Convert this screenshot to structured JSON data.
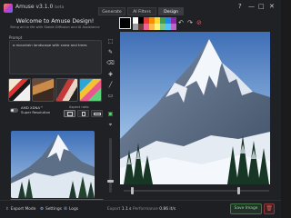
{
  "window": {
    "app_name": "Amuse",
    "version": "v3.1.0",
    "version_suffix": "beta",
    "controls": {
      "help": "?",
      "minimize": "—",
      "maximize": "□",
      "close": "✕"
    }
  },
  "tabs": [
    {
      "label": "Generate",
      "active": false
    },
    {
      "label": "AI Filters",
      "active": false
    },
    {
      "label": "Design",
      "active": true
    }
  ],
  "left_panel": {
    "welcome_title": "Welcome to Amuse Design!",
    "welcome_subtitle": "Bring art to life with Stable Diffusion and AI Assistance",
    "prompt_label": "Prompt",
    "prompt_text": "a mountain landscape with snow and trees",
    "styles": [
      "style-1",
      "style-2",
      "style-3",
      "style-4"
    ],
    "upscaler_label_line1": "AMD XDNA™",
    "upscaler_label_line2": "Super Resolution",
    "upscaler_enabled": false,
    "aspect_label": "Aspect ratio",
    "aspect_options": [
      "square",
      "portrait",
      "landscape"
    ],
    "aspect_selected": "square",
    "generate_label": "Generate Image"
  },
  "toolbar": {
    "primary_color": "#000000",
    "palette": [
      "#ffffff",
      "#000000",
      "#e53935",
      "#fb8c00",
      "#fdd835",
      "#43a047",
      "#1e88e5",
      "#8e24aa",
      "#9e9e9e",
      "#5d4037",
      "#f06292",
      "#ffb74d",
      "#fff176",
      "#81c784",
      "#4fc3f7",
      "#ba68c8"
    ]
  },
  "bottom_bar": {
    "export_label": "Export Mode",
    "settings_label": "Settings",
    "logs_label": "Logs",
    "export_time_label": "Export",
    "export_time_value": "1.1 s",
    "performance_label": "Performance",
    "performance_value": "0.86 it/s",
    "save_label": "Save Image"
  },
  "sliders": {
    "brush_size": 0.2,
    "canvas_left": 0.05,
    "canvas_right": 0.78
  }
}
